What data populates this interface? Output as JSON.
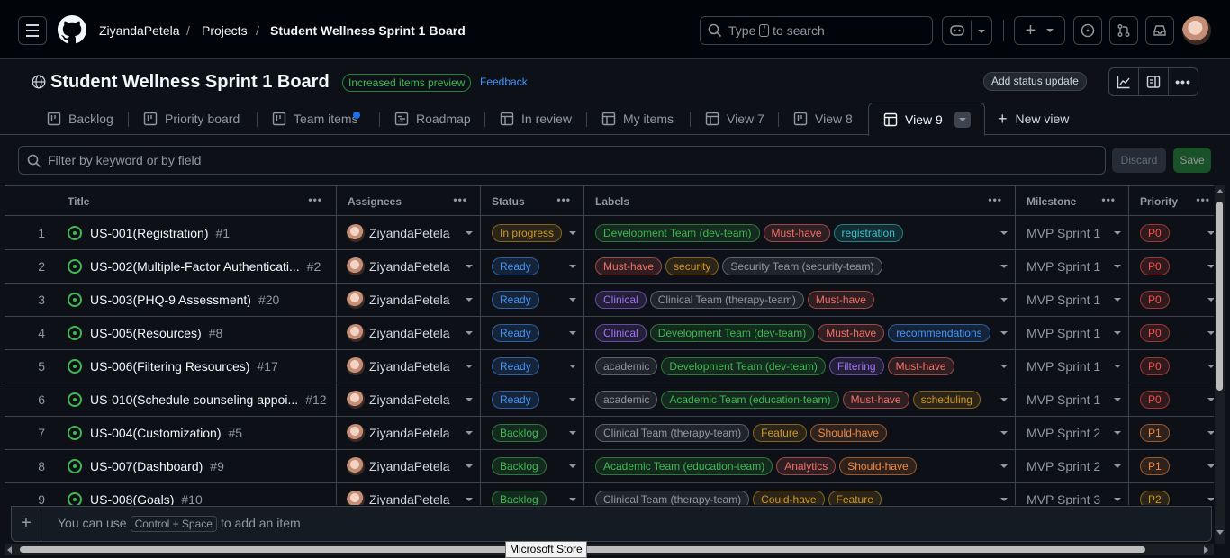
{
  "header": {
    "breadcrumbs": [
      "ZiyandaPetela",
      "/",
      "Projects",
      "/",
      "Student Wellness Sprint 1 Board"
    ],
    "search_prefix": "Type",
    "search_key": "/",
    "search_suffix": "to search"
  },
  "project": {
    "title": "Student Wellness Sprint 1 Board",
    "preview_badge": "Increased items preview",
    "feedback_link": "Feedback",
    "status_update_button": "Add status update"
  },
  "tabs": [
    {
      "label": "Backlog",
      "icon": "board-icon"
    },
    {
      "label": "Priority board",
      "icon": "board-icon"
    },
    {
      "label": "Team items",
      "icon": "board-icon"
    },
    {
      "label": "Roadmap",
      "icon": "roadmap-icon"
    },
    {
      "label": "In review",
      "icon": "table-icon"
    },
    {
      "label": "My items",
      "icon": "table-icon"
    },
    {
      "label": "View 7",
      "icon": "table-icon"
    },
    {
      "label": "View 8",
      "icon": "board-icon"
    },
    {
      "label": "View 9",
      "icon": "table-icon",
      "active": true
    }
  ],
  "new_view_label": "New view",
  "filter": {
    "placeholder": "Filter by keyword or by field",
    "discard": "Discard",
    "save": "Save"
  },
  "columns": [
    "Title",
    "Assignees",
    "Status",
    "Labels",
    "Milestone",
    "Priority"
  ],
  "label_colors": {
    "Development Team (dev-team)": "#3fb950",
    "Must-have": "#f47067",
    "registration": "#39c5cf",
    "security": "#d29922",
    "Security Team (security-team)": "#9198a1",
    "Clinical": "#a371f7",
    "Clinical Team (therapy-team)": "#9198a1",
    "recommendations": "#4493f8",
    "academic": "#9198a1",
    "Filtering": "#a371f7",
    "Academic Team (education-team)": "#3fb950",
    "scheduling": "#d29922",
    "Feature": "#d29922",
    "Should-have": "#f0883e",
    "Analytics": "#f47067",
    "Could-have": "#d29922"
  },
  "status_colors": {
    "In progress": "#d29922",
    "Ready": "#4493f8",
    "Backlog": "#3fb950"
  },
  "priority_colors": {
    "P0": "#f85149",
    "P1": "#f0883e",
    "P2": "#d29922"
  },
  "rows": [
    {
      "num": "1",
      "title": "US-001(Registration)",
      "issue": "#1",
      "assignee": "ZiyandaPetela",
      "status": "In progress",
      "labels": [
        "Development Team (dev-team)",
        "Must-have",
        "registration"
      ],
      "milestone": "MVP Sprint 1",
      "priority": "P0"
    },
    {
      "num": "2",
      "title": "US-002(Multiple-Factor Authenticati...",
      "issue": "#2",
      "assignee": "ZiyandaPetela",
      "status": "Ready",
      "labels": [
        "Must-have",
        "security",
        "Security Team (security-team)"
      ],
      "milestone": "MVP Sprint 1",
      "priority": "P0"
    },
    {
      "num": "3",
      "title": "US-003(PHQ-9 Assessment)",
      "issue": "#20",
      "assignee": "ZiyandaPetela",
      "status": "Ready",
      "labels": [
        "Clinical",
        "Clinical Team (therapy-team)",
        "Must-have"
      ],
      "milestone": "MVP Sprint 1",
      "priority": "P0"
    },
    {
      "num": "4",
      "title": "US-005(Resources)",
      "issue": "#8",
      "assignee": "ZiyandaPetela",
      "status": "Ready",
      "labels": [
        "Clinical",
        "Development Team (dev-team)",
        "Must-have",
        "recommendations"
      ],
      "milestone": "MVP Sprint 1",
      "priority": "P0"
    },
    {
      "num": "5",
      "title": "US-006(Filtering Resources)",
      "issue": "#17",
      "assignee": "ZiyandaPetela",
      "status": "Ready",
      "labels": [
        "academic",
        "Development Team (dev-team)",
        "Filtering",
        "Must-have"
      ],
      "milestone": "MVP Sprint 1",
      "priority": "P0"
    },
    {
      "num": "6",
      "title": "US-010(Schedule counseling appoi...",
      "issue": "#12",
      "assignee": "ZiyandaPetela",
      "status": "Ready",
      "labels": [
        "academic",
        "Academic Team (education-team)",
        "Must-have",
        "scheduling"
      ],
      "milestone": "MVP Sprint 1",
      "priority": "P0"
    },
    {
      "num": "7",
      "title": "US-004(Customization)",
      "issue": "#5",
      "assignee": "ZiyandaPetela",
      "status": "Backlog",
      "labels": [
        "Clinical Team (therapy-team)",
        "Feature",
        "Should-have"
      ],
      "milestone": "MVP Sprint 2",
      "priority": "P1"
    },
    {
      "num": "8",
      "title": "US-007(Dashboard)",
      "issue": "#9",
      "assignee": "ZiyandaPetela",
      "status": "Backlog",
      "labels": [
        "Academic Team (education-team)",
        "Analytics",
        "Should-have"
      ],
      "milestone": "MVP Sprint 2",
      "priority": "P1"
    },
    {
      "num": "9",
      "title": "US-008(Goals)",
      "issue": "#10",
      "assignee": "ZiyandaPetela",
      "status": "Backlog",
      "labels": [
        "Clinical Team (therapy-team)",
        "Could-have",
        "Feature"
      ],
      "milestone": "MVP Sprint 3",
      "priority": "P2"
    }
  ],
  "add_item": {
    "prefix": "You can use",
    "shortcut": "Control + Space",
    "suffix": "to add an item"
  },
  "tooltip": "Microsoft Store"
}
